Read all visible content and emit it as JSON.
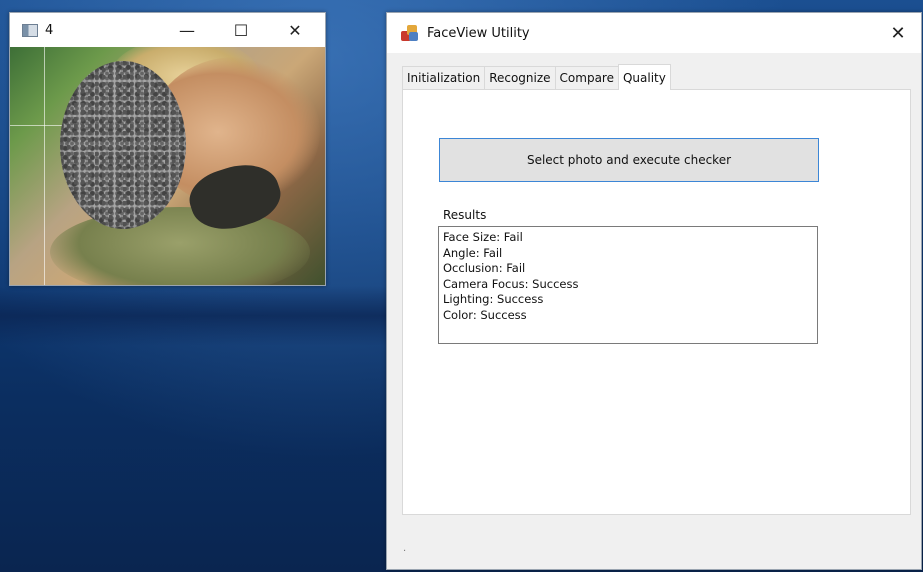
{
  "image_window": {
    "title": "4",
    "minimize_glyph": "—",
    "maximize_glyph": "☐",
    "close_glyph": "✕"
  },
  "faceview_window": {
    "title": "FaceView Utility",
    "close_glyph": "✕",
    "tabs": [
      {
        "label": "Initialization",
        "active": false
      },
      {
        "label": "Recognize",
        "active": false
      },
      {
        "label": "Compare",
        "active": false
      },
      {
        "label": "Quality",
        "active": true
      }
    ],
    "quality": {
      "execute_button_label": "Select photo and execute checker",
      "results_label": "Results",
      "results": [
        "Face Size: Fail",
        "Angle: Fail",
        "Occlusion: Fail",
        "Camera Focus: Success",
        "Lighting: Success",
        "Color: Success"
      ]
    },
    "status_text": "."
  },
  "colors": {
    "desktop_blue": "#0f3c78",
    "button_focus_border": "#3c86d6"
  }
}
